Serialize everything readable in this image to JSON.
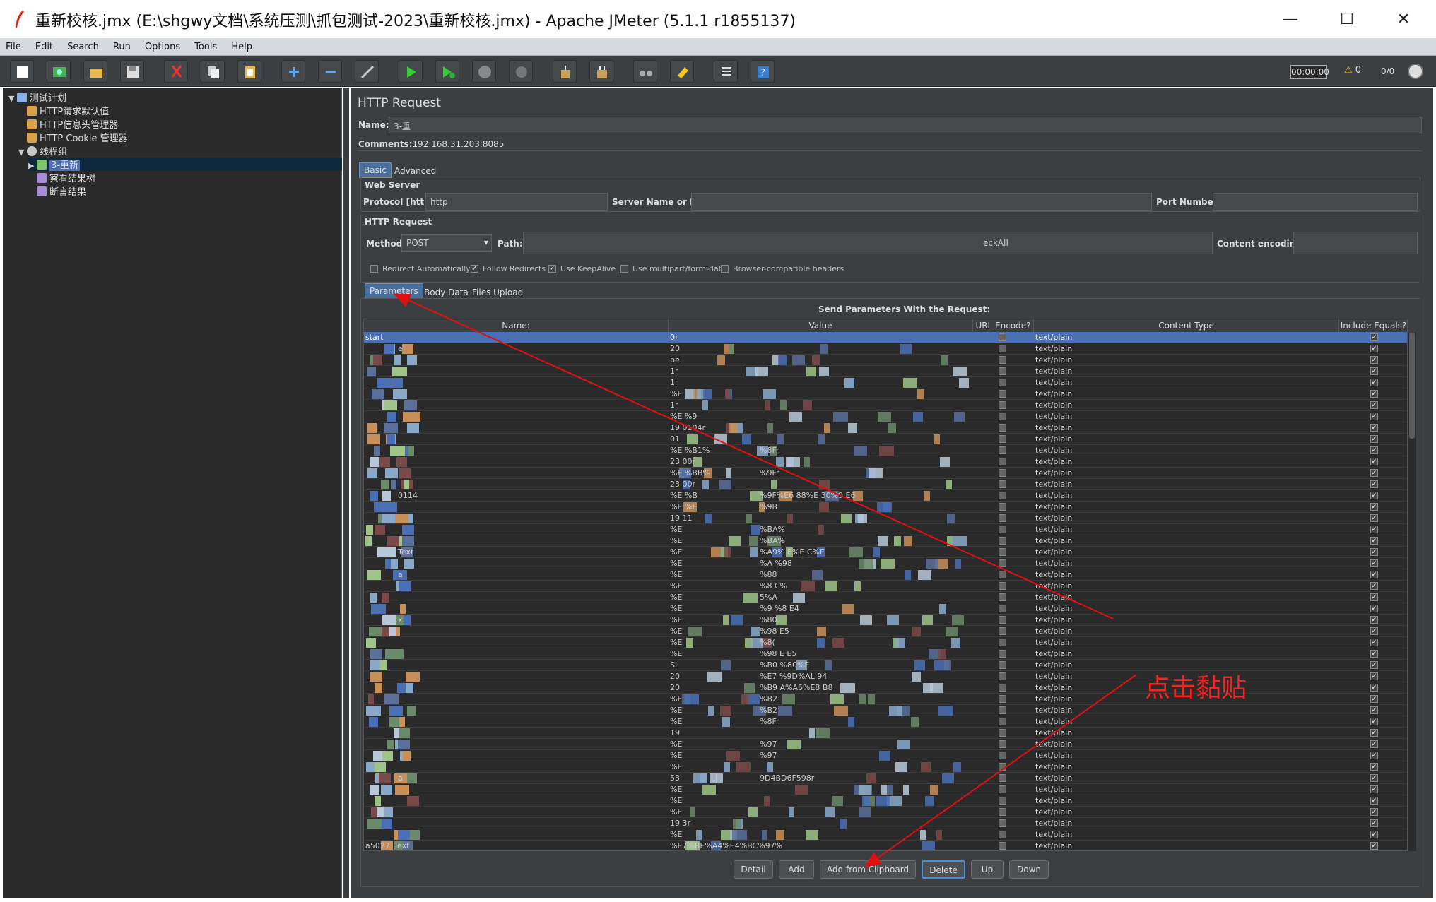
{
  "window": {
    "title": "重新校核.jmx (E:\\shgwy文档\\系统压测\\抓包测试-2023\\重新校核.jmx) - Apache JMeter (5.1.1 r1855137)",
    "min": "—",
    "max": "☐",
    "close": "✕"
  },
  "menu": [
    "File",
    "Edit",
    "Search",
    "Run",
    "Options",
    "Tools",
    "Help"
  ],
  "status": {
    "timer": "00:00:00",
    "warnings": "0",
    "threads": "0/0"
  },
  "tree": [
    {
      "label": "测试计划",
      "indent": 0,
      "icon": "test-plan-icon"
    },
    {
      "label": "HTTP请求默认值",
      "indent": 1,
      "icon": "config-icon"
    },
    {
      "label": "HTTP信息头管理器",
      "indent": 1,
      "icon": "config-icon"
    },
    {
      "label": "HTTP Cookie 管理器",
      "indent": 1,
      "icon": "config-icon"
    },
    {
      "label": "线程组",
      "indent": 1,
      "icon": "gear-icon"
    },
    {
      "label": "3-重新",
      "indent": 2,
      "icon": "sampler-icon",
      "selected": true
    },
    {
      "label": "察看结果树",
      "indent": 2,
      "icon": "listener-icon"
    },
    {
      "label": "断言结果",
      "indent": 2,
      "icon": "listener-icon"
    }
  ],
  "panel": {
    "heading": "HTTP Request",
    "name_label": "Name:",
    "name_value": "3-重",
    "comments_label": "Comments:",
    "comments_value": "192.168.31.203:8085",
    "tab_basic": "Basic",
    "tab_advanced": "Advanced",
    "web_server": "Web Server",
    "protocol_label": "Protocol [http]:",
    "protocol_value": "http",
    "server_label": "Server Name or IP:",
    "port_label": "Port Number:",
    "http_request": "HTTP Request",
    "method_label": "Method:",
    "method_value": "POST",
    "path_label": "Path:",
    "path_value": "eckAll",
    "encoding_label": "Content encoding:",
    "checkboxes": [
      {
        "label": "Redirect Automatically",
        "checked": false
      },
      {
        "label": "Follow Redirects",
        "checked": true
      },
      {
        "label": "Use KeepAlive",
        "checked": true
      },
      {
        "label": "Use multipart/form-data",
        "checked": false
      },
      {
        "label": "Browser-compatible headers",
        "checked": false
      }
    ],
    "subtabs": [
      "Parameters",
      "Body Data",
      "Files Upload"
    ],
    "send_params": "Send Parameters With the Request:",
    "columns": [
      "Name:",
      "Value",
      "URL Encode?",
      "Content-Type",
      "Include Equals?"
    ],
    "content_type": "text/plain",
    "buttons": [
      "Detail",
      "Add",
      "Add from Clipboard",
      "Delete",
      "Up",
      "Down"
    ],
    "first_row": {
      "name": "start",
      "value": "0r"
    },
    "last_row": {
      "name": "a5027_Text",
      "value": "%E7%BE%A4%E4%BC%97%"
    },
    "values": [
      "20",
      "pe",
      "1r",
      "1r",
      "%E",
      "1r",
      "%E %9",
      "19 0104r",
      "01",
      "%E %B1%",
      "23 00r",
      "%E %BB%",
      "23 00r",
      "%E %B",
      "%E %E",
      "19 11",
      "%E",
      "%E",
      "%E",
      "%E",
      "%E",
      "%E",
      "%E",
      "%E",
      "%E",
      "%E",
      "%E",
      "%E",
      "SI",
      "20",
      "20",
      "%E",
      "%E",
      "%E",
      "19",
      "%E",
      "%E",
      "%E",
      "53",
      "%E",
      "%E",
      "%E",
      "19 3r",
      "%E"
    ],
    "name_fragments": [
      "e",
      "",
      "",
      "",
      "",
      "",
      "",
      "",
      "",
      "",
      "",
      "",
      "",
      "0114",
      "",
      "",
      "",
      "",
      "Text",
      "",
      "a",
      "",
      "",
      "",
      "x",
      "",
      "",
      "",
      "",
      "",
      "",
      "",
      "",
      "",
      "",
      "",
      "",
      "",
      "a",
      "",
      "",
      "",
      "",
      "",
      ""
    ],
    "value_fragments": [
      "",
      "",
      "",
      "",
      "",
      "",
      "",
      "",
      "",
      "%8Fr",
      "",
      "%9Fr",
      "",
      "%9F%E6 88%E 30%9 E6",
      "%9B",
      "",
      "%BA%",
      "%BA%",
      "%A9% 8%E C%E",
      "%A %98",
      "%88",
      "%8 C%",
      "5%A",
      "%9 %8 E4",
      "%80",
      "%98 E5",
      "%8(",
      "%98 E E5",
      "%B0 %80%E",
      "%E7 %9D%AL 94",
      "%B9 A%A6%E8 B8",
      "%B2",
      "%B2",
      "%8Fr",
      "",
      "%97",
      "%97",
      "",
      "9D4BD6F598r",
      "",
      "",
      "",
      "",
      ""
    ]
  },
  "annotation": "点击黏贴",
  "colors": {
    "accent": "#4a6fb5",
    "arrow": "#e01010"
  }
}
